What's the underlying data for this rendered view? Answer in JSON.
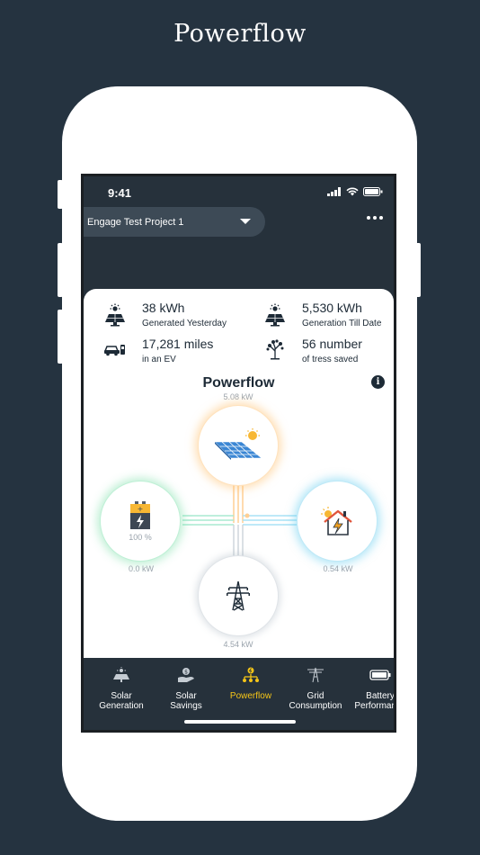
{
  "promo": {
    "title": "Powerflow"
  },
  "status_bar": {
    "time": "9:41"
  },
  "header": {
    "project_name": "Engage Test Project 1"
  },
  "stats": [
    {
      "value": "38 kWh",
      "label": "Generated Yesterday",
      "icon": "solar-panel-sun-icon"
    },
    {
      "value": "5,530 kWh",
      "label": "Generation Till Date",
      "icon": "solar-panel-sun-icon"
    },
    {
      "value": "17,281 miles",
      "label": "in an EV",
      "icon": "ev-car-icon"
    },
    {
      "value": "56 number",
      "label": "of tress saved",
      "icon": "tree-icon"
    }
  ],
  "powerflow": {
    "title": "Powerflow",
    "solar_kw": "5.08 kW",
    "battery_pct": "100 %",
    "battery_kw": "0.0 kW",
    "home_kw": "0.54 kW",
    "grid_kw": "4.54 kW",
    "colors": {
      "solar": "#ffc478",
      "battery": "#6edca0",
      "home": "#64cdf0",
      "grid": "#b4bec8"
    }
  },
  "tabs": [
    {
      "label": "Solar\nGeneration",
      "icon": "solar-panel-icon",
      "active": false
    },
    {
      "label": "Solar\nSavings",
      "icon": "savings-hand-icon",
      "active": false
    },
    {
      "label": "Powerflow",
      "icon": "powerflow-icon",
      "active": true
    },
    {
      "label": "Grid\nConsumption",
      "icon": "grid-tower-icon",
      "active": false
    },
    {
      "label": "Battery\nPerformance",
      "icon": "battery-icon",
      "active": false
    }
  ],
  "colors": {
    "background": "#253340",
    "accent": "#f5c518",
    "text_dark": "#1d2a36"
  }
}
